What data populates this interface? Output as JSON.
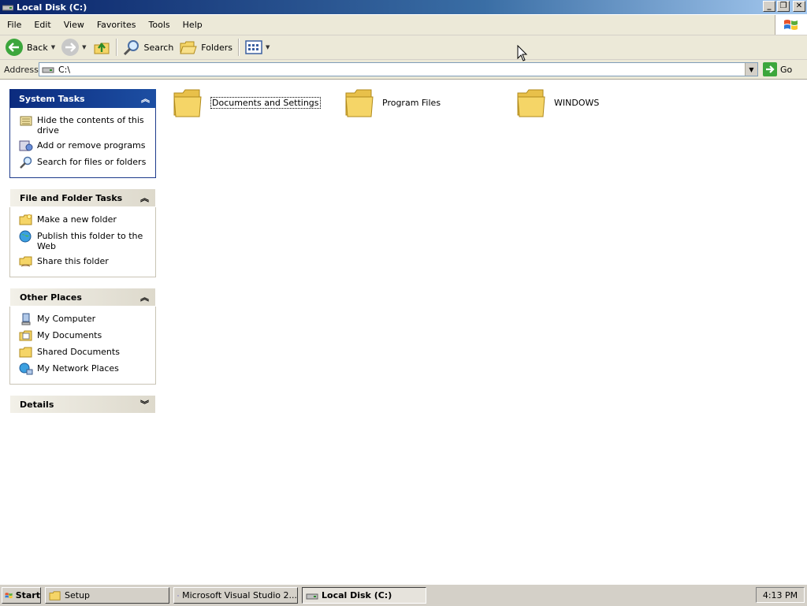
{
  "window": {
    "title": "Local Disk (C:)"
  },
  "menu": [
    "File",
    "Edit",
    "View",
    "Favorites",
    "Tools",
    "Help"
  ],
  "toolbar": {
    "back_label": "Back",
    "search_label": "Search",
    "folders_label": "Folders"
  },
  "address": {
    "label": "Address",
    "value": "C:\\",
    "go_label": "Go"
  },
  "panels": {
    "system_tasks": {
      "title": "System Tasks",
      "items": [
        "Hide the contents of this drive",
        "Add or remove programs",
        "Search for files or folders"
      ]
    },
    "file_folder_tasks": {
      "title": "File and Folder Tasks",
      "items": [
        "Make a new folder",
        "Publish this folder to the Web",
        "Share this folder"
      ]
    },
    "other_places": {
      "title": "Other Places",
      "items": [
        "My Computer",
        "My Documents",
        "Shared Documents",
        "My Network Places"
      ]
    },
    "details": {
      "title": "Details"
    }
  },
  "folders": [
    "Documents and Settings",
    "Program Files",
    "WINDOWS"
  ],
  "taskbar": {
    "start_label": "Start",
    "buttons": [
      "Setup",
      "Microsoft Visual Studio 2...",
      "Local Disk (C:)"
    ],
    "clock": "4:13 PM"
  },
  "colors": {
    "titlebar": "#0a246a",
    "taskpane_header": "#0b2b7e",
    "chrome": "#ece9d8",
    "folder_yellow": "#f5d567"
  }
}
